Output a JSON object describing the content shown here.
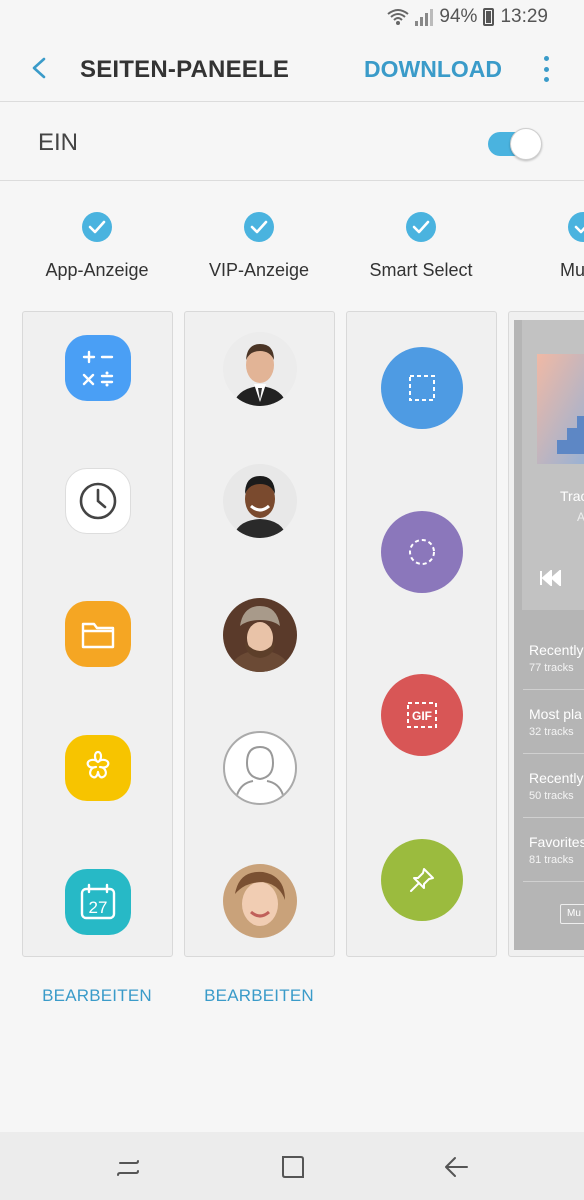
{
  "status": {
    "battery": "94%",
    "time": "13:29"
  },
  "header": {
    "title": "SEITEN-PANEELE",
    "download_label": "DOWNLOAD"
  },
  "switch": {
    "label": "EIN",
    "state": "on"
  },
  "panels": [
    {
      "name": "App-Anzeige",
      "checked": true,
      "edit_label": "BEARBEITEN"
    },
    {
      "name": "VIP-Anzeige",
      "checked": true,
      "edit_label": "BEARBEITEN"
    },
    {
      "name": "Smart Select",
      "checked": true
    },
    {
      "name": "Mu",
      "checked": true
    }
  ],
  "app_panel": {
    "apps": [
      {
        "icon": "calculator-icon",
        "color": "#4a9ff5"
      },
      {
        "icon": "clock-icon",
        "color": "#ffffff"
      },
      {
        "icon": "folder-icon",
        "color": "#f5a623"
      },
      {
        "icon": "bixby-flower-icon",
        "color": "#f7c400"
      },
      {
        "icon": "calendar-icon",
        "color": "#27b9c6",
        "date": "27"
      }
    ]
  },
  "smart_select": {
    "tools": [
      {
        "icon": "rectangle-select-icon",
        "color": "#4e9be3"
      },
      {
        "icon": "oval-select-icon",
        "color": "#8b77bb"
      },
      {
        "icon": "gif-icon",
        "color": "#d85656",
        "text": "GIF"
      },
      {
        "icon": "pin-icon",
        "color": "#9bbb3e"
      }
    ]
  },
  "music_panel": {
    "track_title": "Trac",
    "track_artist": "Ar",
    "playlists": [
      {
        "name": "Recently",
        "count": "77 tracks"
      },
      {
        "name": "Most pla",
        "count": "32 tracks"
      },
      {
        "name": "Recently",
        "count": "50 tracks"
      },
      {
        "name": "Favorites",
        "count": "81 tracks"
      }
    ],
    "button_label": "Mu"
  },
  "colors": {
    "accent": "#3a9bc9",
    "check": "#4ab3df",
    "toggle_on": "#4ab3df"
  }
}
